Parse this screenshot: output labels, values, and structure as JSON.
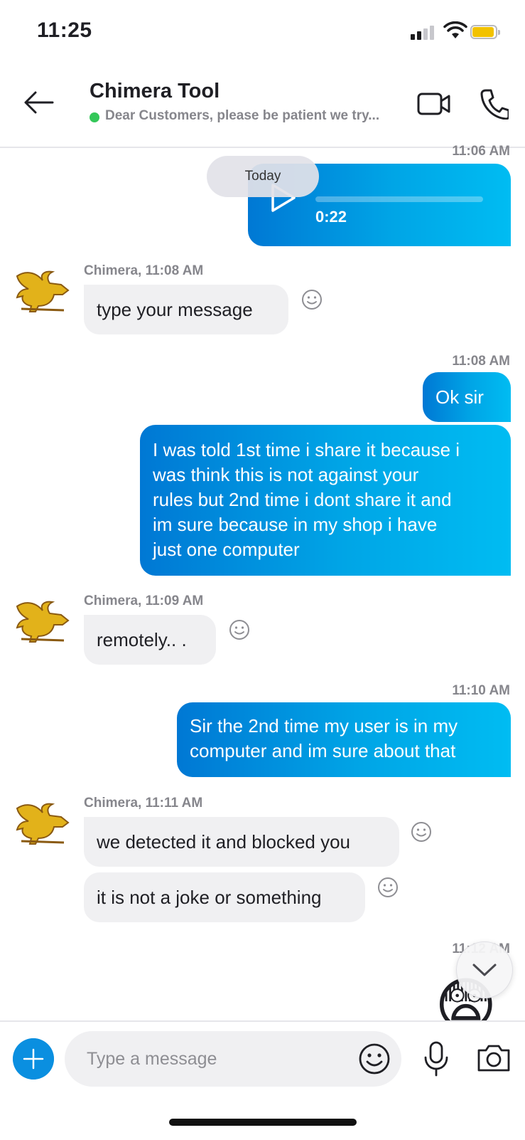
{
  "status_bar": {
    "time": "11:25"
  },
  "header": {
    "title": "Chimera Tool",
    "subtitle": "Dear Customers, please be patient we try..."
  },
  "chat": {
    "date_separator": "Today",
    "messages": [
      {
        "type": "outgoing_voice",
        "timestamp": "11:06 AM",
        "duration": "0:22"
      },
      {
        "type": "incoming",
        "meta": "Chimera, 11:08 AM",
        "text": "type your message"
      },
      {
        "type": "outgoing",
        "timestamp": "11:08 AM",
        "text": "Ok sir"
      },
      {
        "type": "outgoing",
        "lines": [
          "I was told 1st time i share it because i",
          "was think this is not against your",
          "rules but 2nd time i dont share it and",
          "im sure because in my shop i have",
          "just one computer"
        ]
      },
      {
        "type": "incoming",
        "meta": "Chimera, 11:09 AM",
        "text": "remotely.. ."
      },
      {
        "type": "outgoing",
        "timestamp": "11:10 AM",
        "lines": [
          "Sir the 2nd time my user is in my",
          "computer and im sure about that"
        ]
      },
      {
        "type": "incoming",
        "meta": "Chimera, 11:11 AM",
        "text": "we detected it and blocked you"
      },
      {
        "type": "incoming",
        "text": "it is not a joke or something"
      },
      {
        "type": "outgoing_emoji",
        "timestamp": "11:12 AM",
        "emoji": "😨"
      }
    ]
  },
  "composer": {
    "placeholder": "Type a message"
  },
  "colors": {
    "outgoing_gradient_start": "#0078d4",
    "outgoing_gradient_end": "#00bcf2",
    "incoming_bubble": "#f0f0f2",
    "presence_online": "#34c759",
    "add_button": "#0a8fe0",
    "battery": "#f2c200"
  },
  "icons": [
    "signal-icon",
    "wifi-icon",
    "battery-icon",
    "back-arrow-icon",
    "video-camera-icon",
    "phone-icon",
    "play-icon",
    "smiley-icon",
    "chevron-down-icon",
    "plus-icon",
    "emoji-icon",
    "microphone-icon",
    "camera-icon"
  ]
}
